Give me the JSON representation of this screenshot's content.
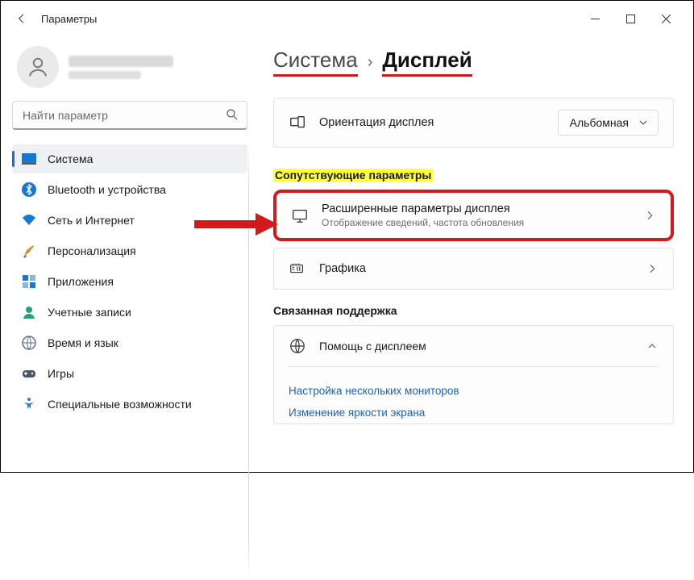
{
  "window": {
    "title": "Параметры"
  },
  "search": {
    "placeholder": "Найти параметр"
  },
  "sidebar": {
    "items": [
      {
        "label": "Система"
      },
      {
        "label": "Bluetooth и устройства"
      },
      {
        "label": "Сеть и Интернет"
      },
      {
        "label": "Персонализация"
      },
      {
        "label": "Приложения"
      },
      {
        "label": "Учетные записи"
      },
      {
        "label": "Время и язык"
      },
      {
        "label": "Игры"
      },
      {
        "label": "Специальные возможности"
      }
    ]
  },
  "breadcrumb": {
    "parent": "Система",
    "current": "Дисплей"
  },
  "orientation": {
    "label": "Ориентация дисплея",
    "value": "Альбомная"
  },
  "section_related": "Сопутствующие параметры",
  "advanced": {
    "label": "Расширенные параметры дисплея",
    "sub": "Отображение сведений, частота обновления"
  },
  "graphics": {
    "label": "Графика"
  },
  "section_support": "Связанная поддержка",
  "help": {
    "label": "Помощь с дисплеем"
  },
  "links": {
    "multi": "Настройка нескольких мониторов",
    "bright": "Изменение яркости экрана"
  }
}
